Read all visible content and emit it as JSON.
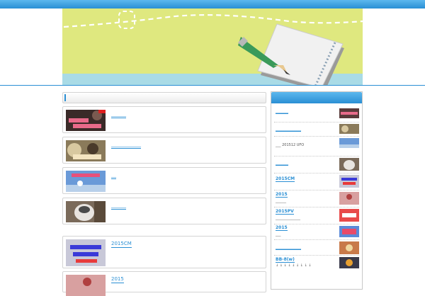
{
  "main": {
    "posts": [
      {
        "title": "______",
        "thumb": "photo-dark-thumb"
      },
      {
        "title": "____________",
        "thumb": "photo-sepia-thumb"
      },
      {
        "title": "__",
        "thumb": "photo-sky-thumb"
      },
      {
        "title": "______",
        "thumb": "photo-dog-thumb"
      },
      {
        "title": "2015CM",
        "thumb": "photo-cloud-thumb"
      },
      {
        "title": "2015",
        "thumb": "photo-red-thumb"
      }
    ]
  },
  "sidebar": {
    "items": [
      {
        "title": "______",
        "sub": ""
      },
      {
        "title": "____________",
        "sub": ""
      },
      {
        "title": "",
        "sub": "___   201512  UFO"
      },
      {
        "title": "______",
        "sub": ""
      },
      {
        "title": "2015CM",
        "sub": ""
      },
      {
        "title": "2015",
        "sub": "______"
      },
      {
        "title": "2015PV",
        "sub": "______________"
      },
      {
        "title": "2015",
        "sub": "___"
      },
      {
        "title": "____________",
        "sub": ""
      },
      {
        "title": "BB-8(w)",
        "sub": "↓ ↓ ↓ ↓ ↓ ↓ ↓ ↓ ↓"
      }
    ]
  },
  "colors": {
    "accent": "#2a8fd4",
    "banner_bg": "#dfe87f",
    "banner_floor": "#a9dbe6"
  }
}
